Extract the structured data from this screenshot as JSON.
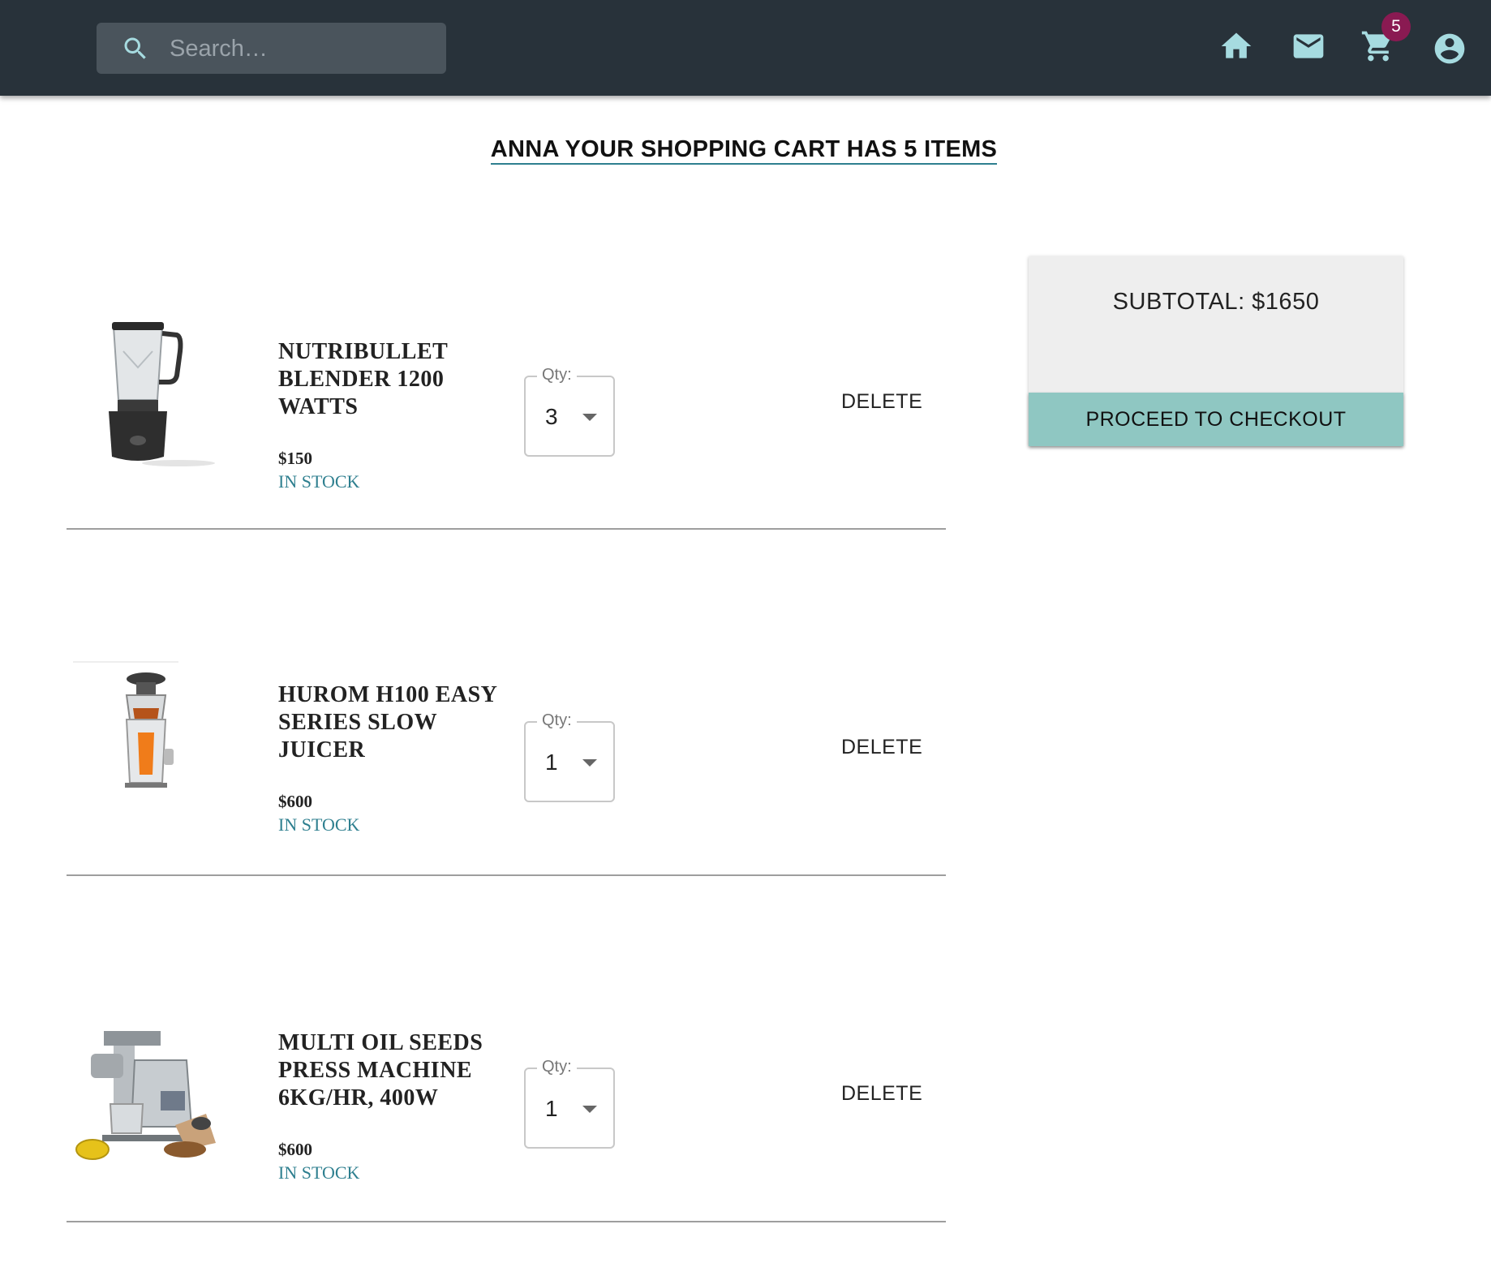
{
  "header": {
    "search_placeholder": "Search…",
    "cart_count": "5",
    "icons": [
      "search-icon",
      "home-icon",
      "mail-icon",
      "cart-icon",
      "account-icon"
    ],
    "colors": {
      "bar": "#28323a",
      "icon": "#a6dbe0",
      "badge": "#8a1a52"
    }
  },
  "page": {
    "heading": "ANNA YOUR SHOPPING CART HAS 5 ITEMS"
  },
  "cart": {
    "items": [
      {
        "name": "NUTRIBULLET BLENDER 1200 WATTS",
        "price": "$150",
        "stock": "IN STOCK",
        "qty_label": "Qty:",
        "qty": "3",
        "delete_label": "DELETE",
        "image_icon": "blender-image"
      },
      {
        "name": "HUROM H100 EASY SERIES SLOW JUICER",
        "price": "$600",
        "stock": "IN STOCK",
        "qty_label": "Qty:",
        "qty": "1",
        "delete_label": "DELETE",
        "image_icon": "juicer-image"
      },
      {
        "name": "MULTI OIL SEEDS PRESS MACHINE 6KG/HR, 400W",
        "price": "$600",
        "stock": "IN STOCK",
        "qty_label": "Qty:",
        "qty": "1",
        "delete_label": "DELETE",
        "image_icon": "oil-press-image"
      }
    ]
  },
  "summary": {
    "subtotal": "SUBTOTAL: $1650",
    "checkout_label": "PROCEED TO CHECKOUT",
    "colors": {
      "button": "#8fc7c2",
      "panel": "#eeeeee",
      "stock": "#2e7f8f"
    }
  }
}
